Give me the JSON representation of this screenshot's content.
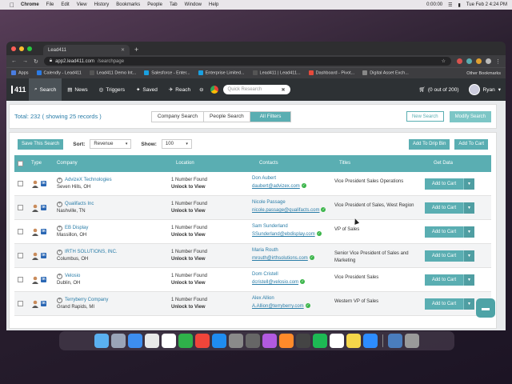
{
  "macbar": {
    "app": "Chrome",
    "menus": [
      "File",
      "Edit",
      "View",
      "History",
      "Bookmarks",
      "People",
      "Tab",
      "Window",
      "Help"
    ],
    "clock_small": "0:00:00",
    "datetime": "Tue Feb 2  4:24 PM"
  },
  "browser": {
    "tab_title": "Lead411",
    "url_host": "app2.lead411.com",
    "url_path": "/searchpage",
    "bookmarks": [
      {
        "label": "Apps",
        "color": "#4a7de0"
      },
      {
        "label": "Calendly - Lead411",
        "color": "#2b7be5"
      },
      {
        "label": "Lead411 Demo Int...",
        "color": "#333"
      },
      {
        "label": "Salesforce - Enter...",
        "color": "#1aa0e0"
      },
      {
        "label": "Enterprise Limited...",
        "color": "#1aa0e0"
      },
      {
        "label": "Lead411 | Lead411...",
        "color": "#333"
      },
      {
        "label": "Dashboard - Pivot...",
        "color": "#e64a3b"
      },
      {
        "label": "Digital Asset Exch...",
        "color": "#888"
      }
    ],
    "other_bookmarks": "Other Bookmarks"
  },
  "appnav": {
    "logo": "411",
    "items": [
      {
        "label": "Search",
        "icon": "search-icon",
        "active": true
      },
      {
        "label": "News",
        "icon": "news-icon"
      },
      {
        "label": "Triggers",
        "icon": "triggers-icon"
      },
      {
        "label": "Saved",
        "icon": "saved-icon"
      },
      {
        "label": "Reach",
        "icon": "reach-icon"
      }
    ],
    "quick_search_placeholder": "Quick Research",
    "cart": "(0 out of 200)",
    "user": "Ryan"
  },
  "summary": {
    "total": "Total: 232 ( showing 25 records )",
    "segments": [
      "Company Search",
      "People Search",
      "All Filters"
    ],
    "new_search": "New Search",
    "modify_search": "Modify Search"
  },
  "toolbar": {
    "save_search": "Save This Search",
    "sort_label": "Sort:",
    "sort_value": "Revenue",
    "show_label": "Show:",
    "show_value": "100",
    "add_drip": "Add To Drip Bin",
    "add_cart": "Add To Cart"
  },
  "table": {
    "headers": [
      "Type",
      "Company",
      "Location",
      "Contacts",
      "Titles",
      "Get Data"
    ],
    "rows": [
      {
        "company": "AdvizeX Technologies",
        "city": "Seven Hills, OH",
        "phone": "1 Number Found",
        "unlock": "Unlock to View",
        "contact": "Don Aubert",
        "email": "daubert@advizex.com",
        "title": "Vice President Sales Operations",
        "action": "Add to Cart"
      },
      {
        "company": "Qualifacts Inc",
        "city": "Nashville, TN",
        "phone": "1 Number Found",
        "unlock": "Unlock to View",
        "contact": "Nicole Passage",
        "email": "nicole.passage@qualifacts.com",
        "title": "Vice President of Sales, West Region",
        "action": "Add to Cart"
      },
      {
        "company": "EB Display",
        "city": "Massillon, OH",
        "phone": "1 Number Found",
        "unlock": "Unlock to View",
        "contact": "Sam Sunderland",
        "email": "SSunderland@ebdisplay.com",
        "title": "VP of Sales",
        "action": "Add to Cart"
      },
      {
        "company": "IRTH SOLUTIONS, INC.",
        "city": "Columbus, OH",
        "phone": "1 Number Found",
        "unlock": "Unlock to View",
        "contact": "Maria Routh",
        "email": "mrouth@irthsolutions.com",
        "title": "Senior Vice President of Sales and Marketing",
        "action": "Add to Cart"
      },
      {
        "company": "Velosio",
        "city": "Dublin, OH",
        "phone": "1 Number Found",
        "unlock": "Unlock to View",
        "contact": "Dom Cristell",
        "email": "dcristell@velosio.com",
        "title": "Vice President Sales",
        "action": "Add to Cart"
      },
      {
        "company": "Terryberry Company",
        "city": "Grand Rapids, MI",
        "phone": "1 Number Found",
        "unlock": "Unlock to View",
        "contact": "Alex Allion",
        "email": "A.Allion@terryberry.com",
        "title": "Western VP of Sales",
        "action": "Add to Cart"
      }
    ]
  },
  "colors": {
    "accent": "#5aaeb2",
    "link": "#2a7da8",
    "nav": "#2d3134",
    "verified": "#3bb54a"
  },
  "dock_icons": [
    "finder",
    "launchpad",
    "safari",
    "chrome",
    "calendar",
    "numbers",
    "news",
    "app-store",
    "system-preferences",
    "screenshot",
    "siri",
    "firefox",
    "calculator",
    "spotify",
    "slack",
    "notes",
    "zoom",
    "downloads",
    "trash"
  ]
}
